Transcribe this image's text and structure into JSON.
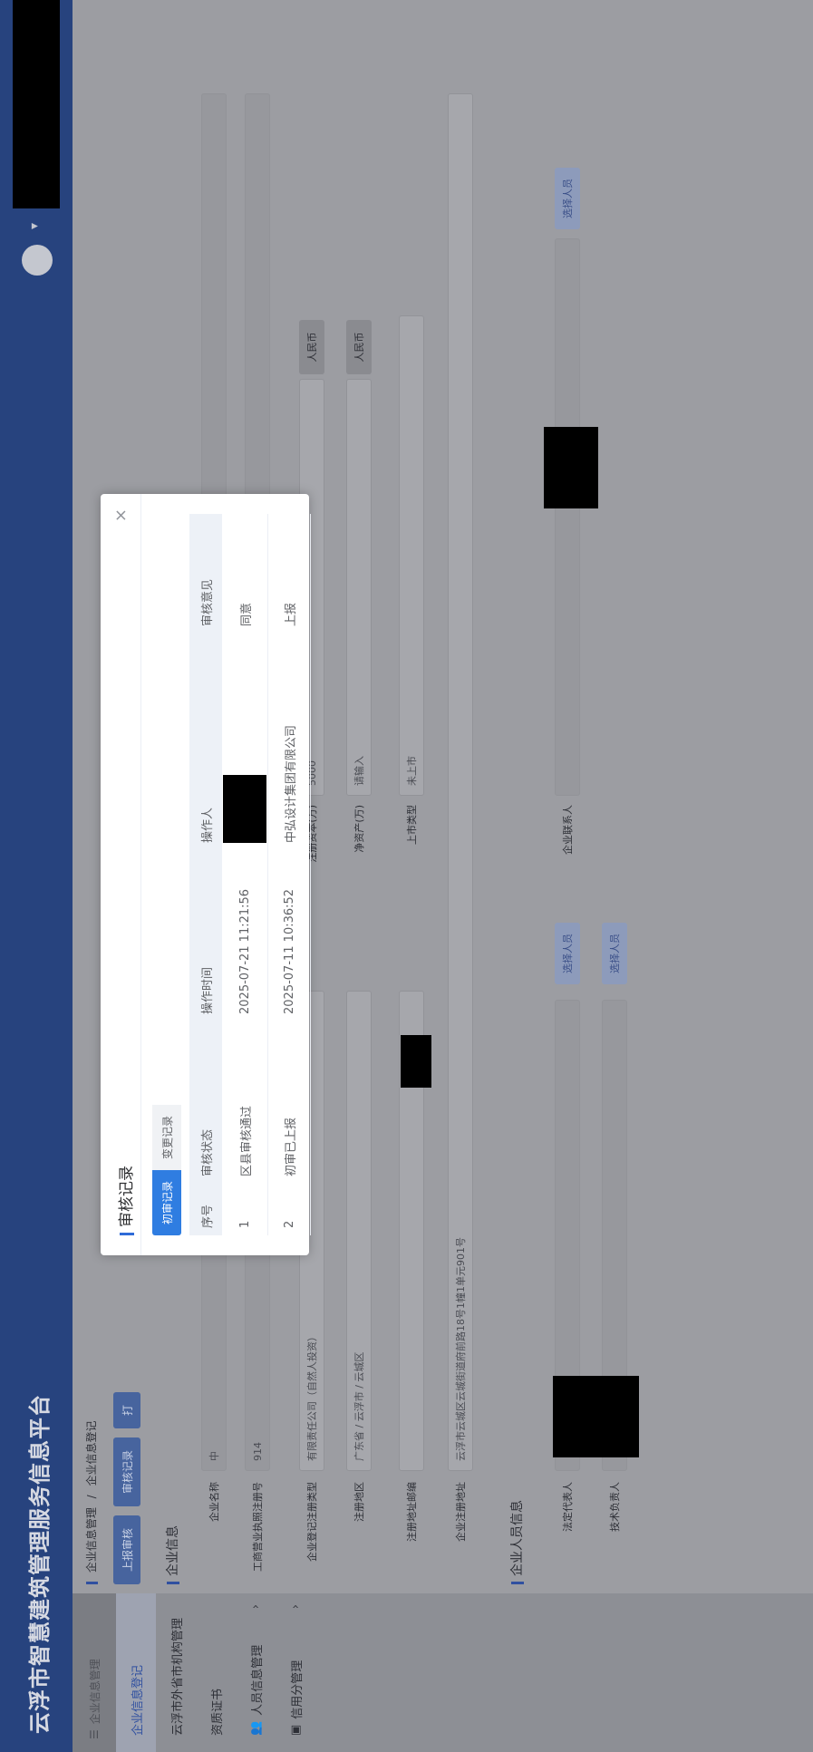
{
  "app": {
    "title": "云浮市智慧建筑管理服务信息平台"
  },
  "sidebar": {
    "header": "企业信息管理",
    "items": [
      {
        "label": "企业信息登记",
        "active": true
      },
      {
        "label": "云浮市外省市机构管理"
      },
      {
        "label": "资质证书"
      },
      {
        "label": "人员信息管理",
        "has_children": true
      },
      {
        "label": "信用分管理",
        "has_children": true
      }
    ]
  },
  "breadcrumb": [
    "企业信息管理",
    "企业信息登记"
  ],
  "toolbar": {
    "buttons": [
      "上报审核",
      "审核记录",
      "打"
    ]
  },
  "company_section": {
    "title": "企业信息",
    "fields": {
      "name_label": "企业名称",
      "name_value": "中",
      "credit_code_label": "工商营业执照注册号",
      "credit_code_value": "914",
      "reg_type_label": "企业登记注册类型",
      "reg_type_value": "有限责任公司（自然人投资）",
      "reg_capital_label": "注册资本(万)",
      "reg_capital_value": "5000",
      "reg_capital_unit": "人民币",
      "reg_area_label": "注册地区",
      "reg_area_value": "广东省 / 云浮市 / 云城区",
      "net_assets_label": "净资产(万)",
      "net_assets_placeholder": "请输入",
      "net_assets_unit": "人民币",
      "postal_code_label": "注册地址邮编",
      "listing_label": "上市类型",
      "listing_value": "未上市",
      "address_label": "企业注册地址",
      "address_value": "云浮市云城区云城街道府前路18号1幢1单元901号"
    }
  },
  "personnel_section": {
    "title": "企业人员信息",
    "legal_rep_label": "法定代表人",
    "tech_lead_label": "技术负责人",
    "contact_label": "企业联系人",
    "select_button": "选择人员"
  },
  "dialog": {
    "title": "审核记录",
    "close_icon": "×",
    "tabs": [
      "初审记录",
      "变更记录"
    ],
    "columns": [
      "序号",
      "审核状态",
      "操作时间",
      "操作人",
      "审核意见"
    ],
    "rows": [
      {
        "no": "1",
        "status": "区县审核通过",
        "time": "2025-07-21 11:21:56",
        "operator": "",
        "comment": "同意"
      },
      {
        "no": "2",
        "status": "初审已上报",
        "time": "2025-07-11 10:36:52",
        "operator": "中弘设计集团有限公司",
        "comment": "上报"
      }
    ]
  }
}
